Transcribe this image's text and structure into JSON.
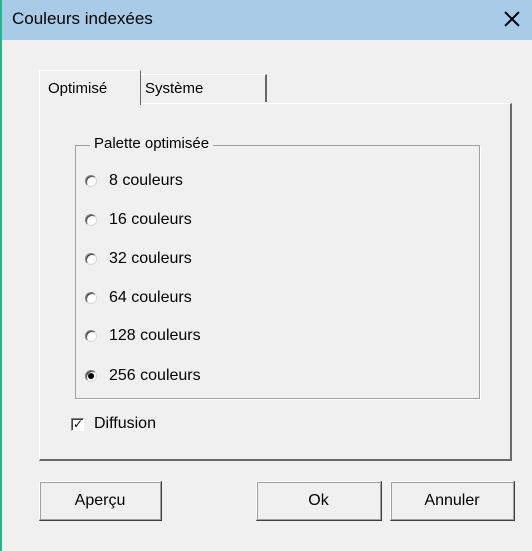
{
  "window": {
    "title": "Couleurs indexées"
  },
  "tabs": [
    {
      "label": "Optimisé",
      "active": true
    },
    {
      "label": "Système",
      "active": false
    }
  ],
  "palette": {
    "group_label": "Palette optimisée",
    "options": [
      {
        "label": "8 couleurs",
        "checked": false
      },
      {
        "label": "16 couleurs",
        "checked": false
      },
      {
        "label": "32 couleurs",
        "checked": false
      },
      {
        "label": "64 couleurs",
        "checked": false
      },
      {
        "label": "128 couleurs",
        "checked": false
      },
      {
        "label": "256 couleurs",
        "checked": true
      }
    ]
  },
  "diffusion": {
    "label": "Diffusion",
    "checked": true,
    "check_glyph": "✓"
  },
  "buttons": {
    "preview": "Aperçu",
    "ok": "Ok",
    "cancel": "Annuler"
  },
  "colors": {
    "titlebar": "#a8cbe8",
    "window_border": "#1fb88a",
    "face": "#f0f0f0"
  },
  "icons": {
    "close": "close-icon"
  }
}
